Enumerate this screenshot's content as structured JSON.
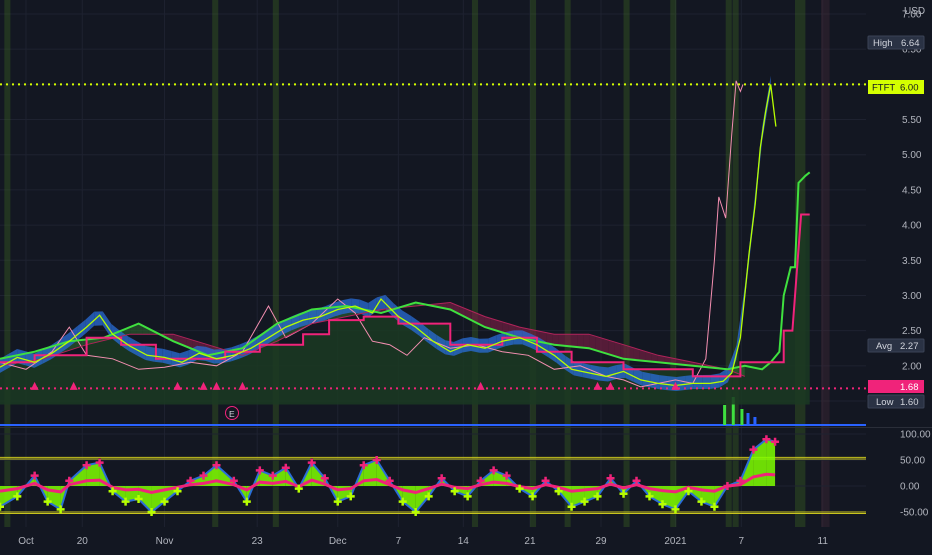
{
  "chart_data": {
    "type": "line",
    "symbol": "FTFT",
    "currency": "USD",
    "main": {
      "ylim": [
        1.3,
        7.0
      ],
      "y_ticks": [
        7.0,
        6.5,
        6.0,
        5.5,
        5.0,
        4.5,
        4.0,
        3.5,
        3.0,
        2.5,
        2.0,
        1.5
      ],
      "y_tick_labels": [
        "7.00",
        "6.50",
        "6.00",
        "5.50",
        "5.00",
        "4.50",
        "4.00",
        "3.50",
        "3.00",
        "2.50",
        "2.00",
        "1.50"
      ],
      "x_ticks": [
        {
          "label": "Oct",
          "t": 0.03
        },
        {
          "label": "20",
          "t": 0.095
        },
        {
          "label": "Nov",
          "t": 0.19
        },
        {
          "label": "23",
          "t": 0.297
        },
        {
          "label": "Dec",
          "t": 0.39
        },
        {
          "label": "7",
          "t": 0.46
        },
        {
          "label": "14",
          "t": 0.535
        },
        {
          "label": "21",
          "t": 0.612
        },
        {
          "label": "29",
          "t": 0.694
        },
        {
          "label": "2021",
          "t": 0.78
        },
        {
          "label": "7",
          "t": 0.856
        },
        {
          "label": "11",
          "t": 0.95
        }
      ],
      "price": [
        [
          0.0,
          1.98
        ],
        [
          0.02,
          2.12
        ],
        [
          0.04,
          2.05
        ],
        [
          0.06,
          2.18
        ],
        [
          0.08,
          2.35
        ],
        [
          0.1,
          2.55
        ],
        [
          0.115,
          2.72
        ],
        [
          0.13,
          2.45
        ],
        [
          0.15,
          2.28
        ],
        [
          0.17,
          2.15
        ],
        [
          0.19,
          2.12
        ],
        [
          0.21,
          2.05
        ],
        [
          0.23,
          2.18
        ],
        [
          0.25,
          2.1
        ],
        [
          0.27,
          2.15
        ],
        [
          0.29,
          2.25
        ],
        [
          0.31,
          2.4
        ],
        [
          0.33,
          2.55
        ],
        [
          0.35,
          2.65
        ],
        [
          0.37,
          2.7
        ],
        [
          0.39,
          2.8
        ],
        [
          0.41,
          2.85
        ],
        [
          0.43,
          2.75
        ],
        [
          0.44,
          2.95
        ],
        [
          0.46,
          2.7
        ],
        [
          0.48,
          2.55
        ],
        [
          0.5,
          2.35
        ],
        [
          0.52,
          2.2
        ],
        [
          0.54,
          2.3
        ],
        [
          0.56,
          2.25
        ],
        [
          0.58,
          2.35
        ],
        [
          0.6,
          2.4
        ],
        [
          0.62,
          2.3
        ],
        [
          0.64,
          2.15
        ],
        [
          0.66,
          1.95
        ],
        [
          0.68,
          1.9
        ],
        [
          0.7,
          1.85
        ],
        [
          0.72,
          1.92
        ],
        [
          0.74,
          1.8
        ],
        [
          0.76,
          1.75
        ],
        [
          0.78,
          1.72
        ],
        [
          0.8,
          1.75
        ],
        [
          0.82,
          1.75
        ],
        [
          0.835,
          1.78
        ],
        [
          0.845,
          1.9
        ],
        [
          0.855,
          2.4
        ],
        [
          0.865,
          3.6
        ],
        [
          0.872,
          4.3
        ],
        [
          0.878,
          5.1
        ],
        [
          0.884,
          5.6
        ],
        [
          0.89,
          6.0
        ],
        [
          0.896,
          5.4
        ]
      ],
      "pink_line": [
        [
          0.0,
          2.05
        ],
        [
          0.03,
          1.95
        ],
        [
          0.06,
          2.2
        ],
        [
          0.08,
          2.55
        ],
        [
          0.1,
          2.15
        ],
        [
          0.13,
          2.1
        ],
        [
          0.16,
          1.95
        ],
        [
          0.19,
          1.98
        ],
        [
          0.22,
          2.05
        ],
        [
          0.25,
          2.0
        ],
        [
          0.28,
          2.2
        ],
        [
          0.31,
          2.85
        ],
        [
          0.33,
          2.4
        ],
        [
          0.36,
          2.6
        ],
        [
          0.39,
          2.95
        ],
        [
          0.41,
          2.75
        ],
        [
          0.43,
          2.35
        ],
        [
          0.45,
          2.3
        ],
        [
          0.47,
          2.15
        ],
        [
          0.49,
          2.4
        ],
        [
          0.52,
          2.25
        ],
        [
          0.55,
          2.3
        ],
        [
          0.58,
          2.2
        ],
        [
          0.61,
          2.15
        ],
        [
          0.64,
          1.95
        ],
        [
          0.67,
          2.0
        ],
        [
          0.7,
          1.85
        ],
        [
          0.72,
          1.8
        ],
        [
          0.74,
          1.7
        ],
        [
          0.76,
          1.75
        ],
        [
          0.78,
          1.8
        ],
        [
          0.8,
          1.75
        ],
        [
          0.815,
          2.1
        ],
        [
          0.825,
          3.5
        ],
        [
          0.83,
          4.4
        ],
        [
          0.838,
          4.1
        ],
        [
          0.845,
          5.3
        ],
        [
          0.85,
          6.05
        ],
        [
          0.855,
          5.9
        ],
        [
          0.858,
          6.0
        ]
      ],
      "kijun": [
        [
          0.0,
          2.05
        ],
        [
          0.04,
          2.05
        ],
        [
          0.04,
          2.15
        ],
        [
          0.1,
          2.15
        ],
        [
          0.1,
          2.4
        ],
        [
          0.14,
          2.4
        ],
        [
          0.14,
          2.3
        ],
        [
          0.18,
          2.3
        ],
        [
          0.18,
          2.1
        ],
        [
          0.26,
          2.1
        ],
        [
          0.26,
          2.2
        ],
        [
          0.3,
          2.2
        ],
        [
          0.3,
          2.3
        ],
        [
          0.35,
          2.3
        ],
        [
          0.35,
          2.45
        ],
        [
          0.38,
          2.45
        ],
        [
          0.38,
          2.65
        ],
        [
          0.42,
          2.65
        ],
        [
          0.42,
          2.7
        ],
        [
          0.46,
          2.7
        ],
        [
          0.46,
          2.6
        ],
        [
          0.52,
          2.6
        ],
        [
          0.52,
          2.3
        ],
        [
          0.58,
          2.3
        ],
        [
          0.58,
          2.4
        ],
        [
          0.62,
          2.4
        ],
        [
          0.62,
          2.2
        ],
        [
          0.66,
          2.2
        ],
        [
          0.66,
          2.05
        ],
        [
          0.72,
          2.05
        ],
        [
          0.72,
          1.95
        ],
        [
          0.8,
          1.95
        ],
        [
          0.8,
          1.85
        ],
        [
          0.855,
          1.85
        ],
        [
          0.855,
          2.05
        ],
        [
          0.905,
          2.05
        ],
        [
          0.905,
          2.5
        ],
        [
          0.915,
          2.5
        ],
        [
          0.925,
          4.15
        ],
        [
          0.935,
          4.15
        ]
      ],
      "green_line": [
        [
          0.0,
          2.1
        ],
        [
          0.04,
          2.2
        ],
        [
          0.08,
          2.35
        ],
        [
          0.12,
          2.4
        ],
        [
          0.16,
          2.6
        ],
        [
          0.2,
          2.35
        ],
        [
          0.24,
          2.15
        ],
        [
          0.28,
          2.25
        ],
        [
          0.32,
          2.6
        ],
        [
          0.36,
          2.8
        ],
        [
          0.4,
          2.85
        ],
        [
          0.44,
          2.75
        ],
        [
          0.48,
          2.9
        ],
        [
          0.52,
          2.8
        ],
        [
          0.56,
          2.55
        ],
        [
          0.6,
          2.4
        ],
        [
          0.64,
          2.3
        ],
        [
          0.68,
          2.25
        ],
        [
          0.72,
          2.1
        ],
        [
          0.76,
          2.05
        ],
        [
          0.8,
          2.0
        ],
        [
          0.84,
          1.95
        ],
        [
          0.86,
          2.0
        ],
        [
          0.88,
          1.95
        ],
        [
          0.89,
          2.05
        ],
        [
          0.9,
          2.2
        ],
        [
          0.905,
          3.0
        ],
        [
          0.913,
          3.4
        ],
        [
          0.918,
          3.4
        ],
        [
          0.922,
          4.6
        ],
        [
          0.93,
          4.7
        ],
        [
          0.935,
          4.75
        ]
      ],
      "red_cloud_edge": [
        [
          0.0,
          2.0
        ],
        [
          0.05,
          2.1
        ],
        [
          0.1,
          2.3
        ],
        [
          0.15,
          2.45
        ],
        [
          0.2,
          2.45
        ],
        [
          0.24,
          2.3
        ],
        [
          0.28,
          2.15
        ],
        [
          0.32,
          2.35
        ],
        [
          0.36,
          2.6
        ],
        [
          0.4,
          2.7
        ],
        [
          0.44,
          2.8
        ],
        [
          0.48,
          2.85
        ],
        [
          0.52,
          2.9
        ],
        [
          0.56,
          2.7
        ],
        [
          0.6,
          2.55
        ],
        [
          0.64,
          2.45
        ],
        [
          0.68,
          2.45
        ],
        [
          0.72,
          2.3
        ],
        [
          0.76,
          2.15
        ],
        [
          0.8,
          2.05
        ],
        [
          0.84,
          1.95
        ],
        [
          0.86,
          1.85
        ]
      ],
      "low_dotted": 1.68,
      "high_dotted": 6.0,
      "triangles_t": [
        0.04,
        0.085,
        0.205,
        0.235,
        0.25,
        0.28,
        0.555,
        0.69,
        0.705,
        0.78
      ],
      "labels": {
        "currency": "USD",
        "high": "High",
        "high_val": "6.64",
        "symbol": "FTFT",
        "last": "6.00",
        "avg": "Avg",
        "avg_val": "2.27",
        "lastpink": "1.68",
        "low": "Low",
        "low_val": "1.60",
        "earnings": "E"
      },
      "tag_values": {
        "high": 6.64,
        "last": 6.0,
        "avg": 2.27,
        "lastpink": 1.68,
        "low": 1.6
      }
    },
    "oscillator": {
      "ylim": [
        -70,
        112
      ],
      "y_ticks": [
        100,
        50,
        0,
        -50
      ],
      "y_tick_labels": [
        "100.00",
        "50.00",
        "0.00",
        "-50.00"
      ],
      "bands": [
        55,
        52,
        -50,
        -53
      ],
      "values": [
        [
          0.0,
          -40
        ],
        [
          0.02,
          -20
        ],
        [
          0.04,
          20
        ],
        [
          0.055,
          -30
        ],
        [
          0.07,
          -45
        ],
        [
          0.08,
          10
        ],
        [
          0.1,
          40
        ],
        [
          0.115,
          45
        ],
        [
          0.13,
          -10
        ],
        [
          0.145,
          -30
        ],
        [
          0.16,
          -25
        ],
        [
          0.175,
          -50
        ],
        [
          0.19,
          -30
        ],
        [
          0.205,
          -10
        ],
        [
          0.22,
          10
        ],
        [
          0.235,
          20
        ],
        [
          0.25,
          40
        ],
        [
          0.27,
          10
        ],
        [
          0.285,
          -30
        ],
        [
          0.3,
          30
        ],
        [
          0.315,
          20
        ],
        [
          0.33,
          35
        ],
        [
          0.345,
          -5
        ],
        [
          0.36,
          45
        ],
        [
          0.375,
          15
        ],
        [
          0.39,
          -30
        ],
        [
          0.405,
          -20
        ],
        [
          0.42,
          40
        ],
        [
          0.435,
          50
        ],
        [
          0.45,
          10
        ],
        [
          0.465,
          -30
        ],
        [
          0.48,
          -50
        ],
        [
          0.495,
          -20
        ],
        [
          0.51,
          15
        ],
        [
          0.525,
          -10
        ],
        [
          0.54,
          -20
        ],
        [
          0.555,
          10
        ],
        [
          0.57,
          30
        ],
        [
          0.585,
          20
        ],
        [
          0.6,
          -5
        ],
        [
          0.615,
          -20
        ],
        [
          0.63,
          10
        ],
        [
          0.645,
          -10
        ],
        [
          0.66,
          -40
        ],
        [
          0.675,
          -30
        ],
        [
          0.69,
          -20
        ],
        [
          0.705,
          15
        ],
        [
          0.72,
          -15
        ],
        [
          0.735,
          10
        ],
        [
          0.75,
          -20
        ],
        [
          0.765,
          -35
        ],
        [
          0.78,
          -45
        ],
        [
          0.795,
          -10
        ],
        [
          0.81,
          -30
        ],
        [
          0.825,
          -40
        ],
        [
          0.84,
          0
        ],
        [
          0.855,
          10
        ],
        [
          0.87,
          70
        ],
        [
          0.885,
          90
        ],
        [
          0.895,
          85
        ]
      ]
    }
  }
}
